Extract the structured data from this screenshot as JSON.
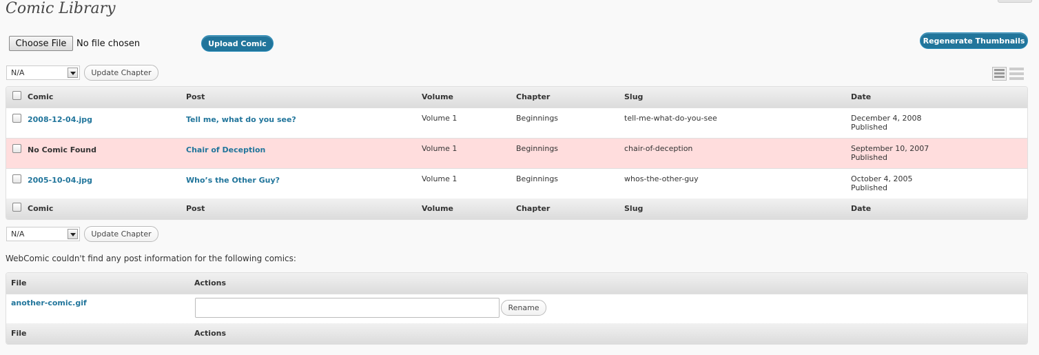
{
  "page": {
    "title": "Comic Library"
  },
  "upload": {
    "choose_file_label": "Choose File",
    "file_status": "No file chosen",
    "upload_label": "Upload Comic",
    "regenerate_label": "Regenerate Thumbnails"
  },
  "bulk_top": {
    "select_value": "N/A",
    "button_label": "Update Chapter"
  },
  "bulk_bottom": {
    "select_value": "N/A",
    "button_label": "Update Chapter"
  },
  "comics_table": {
    "columns": [
      "Comic",
      "Post",
      "Volume",
      "Chapter",
      "Slug",
      "Date"
    ],
    "rows": [
      {
        "comic": "2008-12-04.jpg",
        "post": "Tell me, what do you see?",
        "volume": "Volume 1",
        "chapter": "Beginnings",
        "slug": "tell-me-what-do-you-see",
        "date": "December 4, 2008",
        "status": "Published",
        "comic_found": true
      },
      {
        "comic": "No Comic Found",
        "post": "Chair of Deception",
        "volume": "Volume 1",
        "chapter": "Beginnings",
        "slug": "chair-of-deception",
        "date": "September 10, 2007",
        "status": "Published",
        "comic_found": false
      },
      {
        "comic": "2005-10-04.jpg",
        "post": "Who’s the Other Guy?",
        "volume": "Volume 1",
        "chapter": "Beginnings",
        "slug": "whos-the-other-guy",
        "date": "October 4, 2005",
        "status": "Published",
        "comic_found": true
      }
    ]
  },
  "orphans": {
    "note": "WebComic couldn't find any post information for the following comics:",
    "columns": [
      "File",
      "Actions"
    ],
    "rows": [
      {
        "file": "another-comic.gif",
        "rename_value": "",
        "rename_label": "Rename"
      }
    ]
  },
  "colors": {
    "link": "#21759b",
    "alert_row": "#ffdddd",
    "primary_button": "#21759b"
  },
  "icons": [
    "table-view-icon",
    "list-view-icon",
    "select-arrow-icon"
  ]
}
